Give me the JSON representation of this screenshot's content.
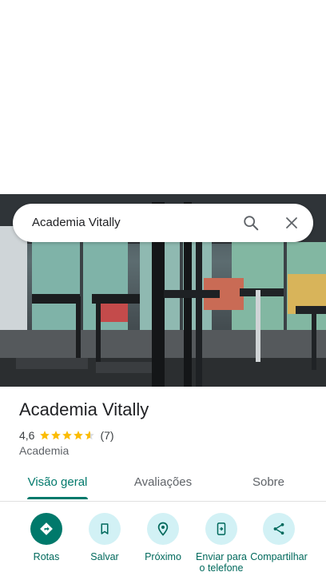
{
  "search": {
    "query": "Academia Vitally"
  },
  "icons": {
    "search": "search-icon",
    "close": "close-icon"
  },
  "place": {
    "name": "Academia Vitally",
    "rating": "4,6",
    "rating_value": 4.6,
    "reviews": "(7)",
    "category": "Academia"
  },
  "tabs": [
    {
      "label": "Visão geral",
      "active": true
    },
    {
      "label": "Avaliações",
      "active": false
    },
    {
      "label": "Sobre",
      "active": false
    }
  ],
  "actions": [
    {
      "label": "Rotas",
      "icon": "directions-icon"
    },
    {
      "label": "Salvar",
      "icon": "bookmark-icon"
    },
    {
      "label": "Próximo",
      "icon": "nearby-icon"
    },
    {
      "label": "Enviar para o telefone",
      "icon": "send-to-phone-icon"
    },
    {
      "label": "Compartilhar",
      "icon": "share-icon"
    }
  ],
  "colors": {
    "accent": "#00796b",
    "action_bg": "#d2f1f5",
    "star": "#fbbc04"
  }
}
